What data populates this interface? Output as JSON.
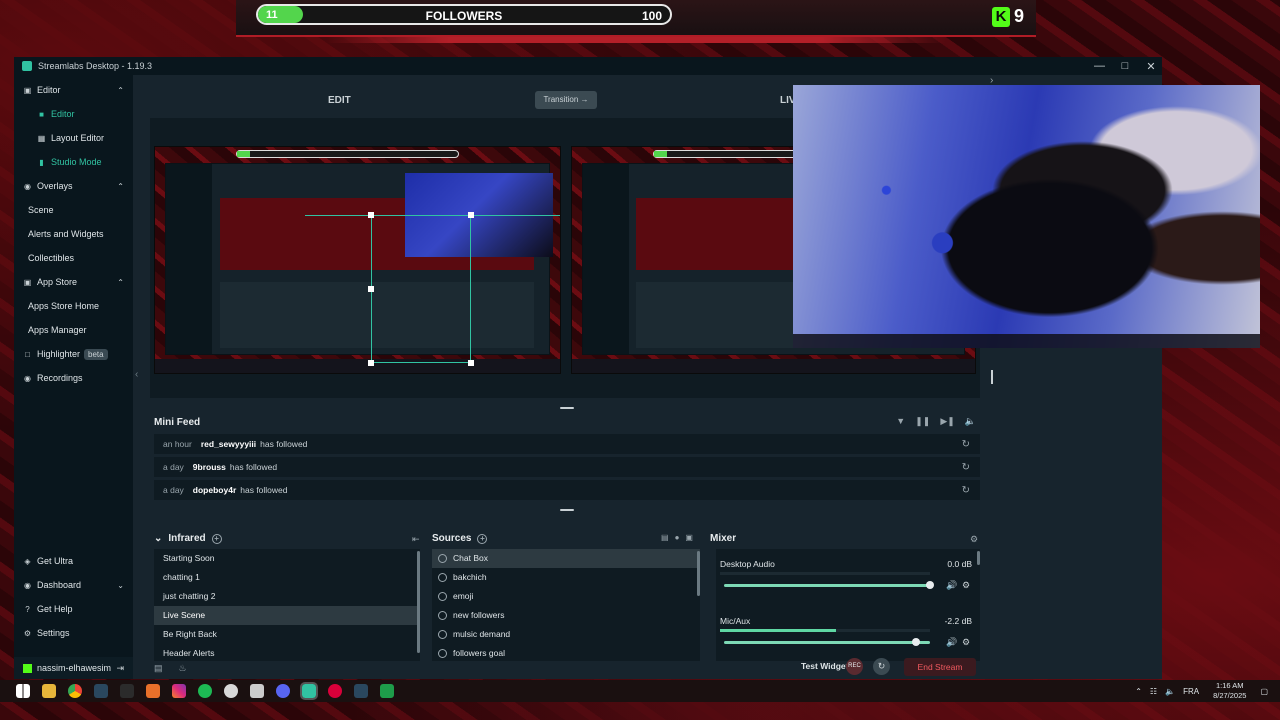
{
  "overlay": {
    "followers_current": "11",
    "followers_label": "FOLLOWERS",
    "followers_goal": "100",
    "followers_progress": 0.11,
    "kick_viewers": "9"
  },
  "window": {
    "title": "Streamlabs Desktop - 1.19.3",
    "minimize": "—",
    "maximize": "□",
    "close": "✕"
  },
  "sidebar": {
    "editor": "Editor",
    "editor_sub": "Editor",
    "layout_editor": "Layout Editor",
    "studio_mode": "Studio Mode",
    "overlays": "Overlays",
    "scene": "Scene",
    "alerts_widgets": "Alerts and Widgets",
    "collectibles": "Collectibles",
    "app_store": "App Store",
    "apps_store_home": "Apps Store Home",
    "apps_manager": "Apps Manager",
    "highlighter": "Highlighter",
    "beta": "beta",
    "recordings": "Recordings",
    "get_ultra": "Get Ultra",
    "dashboard": "Dashboard",
    "get_help": "Get Help",
    "settings": "Settings",
    "username": "nassim-elhawesim"
  },
  "studio": {
    "edit_label": "EDIT",
    "transition_label": "Transition →",
    "live_label": "LIV"
  },
  "feed": {
    "title": "Mini Feed",
    "items": [
      {
        "time": "an hour",
        "user": "red_sewyyyiii",
        "action": "has followed"
      },
      {
        "time": "a day",
        "user": "9brouss",
        "action": "has followed"
      },
      {
        "time": "a day",
        "user": "dopeboy4r",
        "action": "has followed"
      }
    ]
  },
  "scenes": {
    "collection": "Infrared",
    "items": [
      "Starting Soon",
      "chatting 1",
      "just chatting 2",
      "Live Scene",
      "Be Right Back",
      "Header Alerts"
    ],
    "active_index": 3
  },
  "sources": {
    "title": "Sources",
    "items": [
      "Chat Box",
      "bakchich",
      "emoji",
      "new followers",
      "mulsic demand",
      "followers goal"
    ],
    "active_index": 0
  },
  "mixer": {
    "title": "Mixer",
    "channels": [
      {
        "name": "Desktop Audio",
        "db": "0.0 dB",
        "level": 0.0,
        "volume": 1.0
      },
      {
        "name": "Mic/Aux",
        "db": "-2.2 dB",
        "level": 0.55,
        "volume": 0.93
      }
    ]
  },
  "footer": {
    "test_widgets": "Test Widgets",
    "rec": "REC",
    "end_stream": "End Stream"
  },
  "taskbar": {
    "lang": "FRA",
    "time": "1:16 AM",
    "date": "8/27/2025"
  },
  "colors": {
    "accent": "#31c3a2",
    "kick_green": "#53fc18",
    "end_stream_red": "#f05a5f"
  }
}
